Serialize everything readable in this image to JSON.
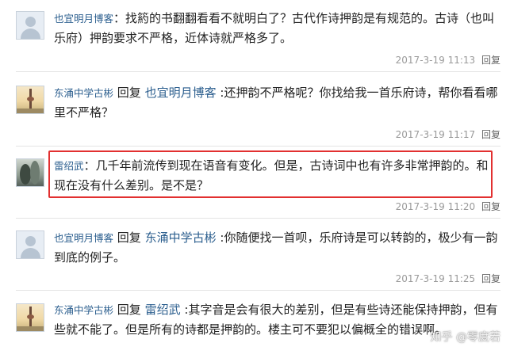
{
  "comments": [
    {
      "author": "也宜明月博客",
      "reply_word": "",
      "target": "",
      "text": "找箹的书翻翻看看不就明白了？古代作诗押韵是有规范的。古诗（也叫乐府）押韵要求不严格，近体诗就严格多了。",
      "timestamp": "2017-3-19 11:13",
      "reply_label": "回复",
      "avatar": "default-avatar-icon"
    },
    {
      "author": "东涌中学古彬",
      "reply_word": "回复",
      "target": "也宜明月博客",
      "text": ":还押韵不严格呢？你找给我一首乐府诗，帮你看看哪里不严格？",
      "timestamp": "2017-3-19 11:17",
      "reply_label": "回复",
      "avatar": "tower-avatar-icon"
    },
    {
      "author": "雷绍武",
      "reply_word": "",
      "target": "",
      "text": "几千年前流传到现在语音有变化。但是，古诗词中也有许多非常押韵的。和现在没有什么差别。是不是？",
      "timestamp": "2017-3-19 11:20",
      "reply_label": "回复",
      "avatar": "plant-avatar-icon"
    },
    {
      "author": "也宜明月博客",
      "reply_word": "回复",
      "target": "东涌中学古彬",
      "text": ":你随便找一首呗，乐府诗是可以转韵的，极少有一韵到底的例子。",
      "timestamp": "2017-3-19 11:25",
      "reply_label": "回复",
      "avatar": "default-avatar-icon"
    },
    {
      "author": "东涌中学古彬",
      "reply_word": "回复",
      "target": "雷绍武",
      "text": ":其字音是会有很大的差别，但是有些诗还能保持押韵，但有些就不能了。但是所有的诗都是押韵的。楼主可不要犯以偏概全的错误啊。",
      "timestamp": "",
      "reply_label": "",
      "avatar": "tower-avatar-icon"
    }
  ],
  "watermark": "知乎 @零度若"
}
